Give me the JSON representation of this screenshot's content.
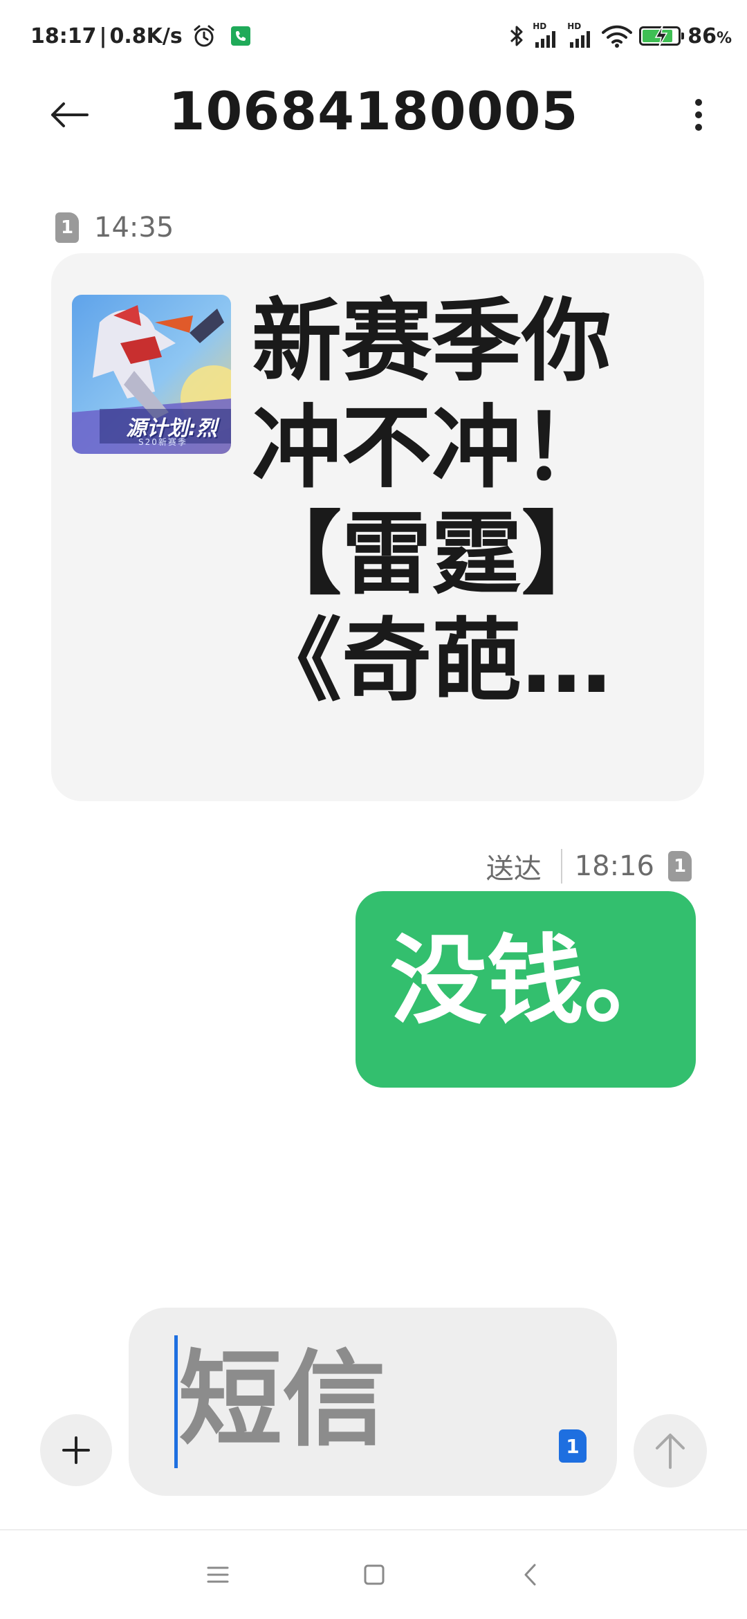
{
  "status_bar": {
    "time": "18:17",
    "separator": "|",
    "net_speed": "0.8K/s",
    "signal_1_label": "HD",
    "signal_2_label": "HD",
    "battery_percent": "86",
    "battery_suffix": "%",
    "battery_level": 0.86,
    "icons": [
      "alarm-icon",
      "phone-call-icon",
      "bluetooth-icon",
      "signal-icon",
      "wifi-icon",
      "battery-charging-icon"
    ]
  },
  "header": {
    "title": "10684180005",
    "back_icon": "arrow-left-icon",
    "more_icon": "more-vertical-icon"
  },
  "messages": [
    {
      "direction": "incoming",
      "sim": "1",
      "time": "14:35",
      "text": "新赛季你冲不冲！【雷霆】《奇葩…",
      "thumbnail_text": "源计划:烈",
      "thumbnail_sub": "S20新赛季"
    },
    {
      "direction": "outgoing",
      "status": "送达",
      "time": "18:16",
      "sim": "1",
      "text": "没钱。"
    }
  ],
  "composer": {
    "placeholder": "短信",
    "sim": "1",
    "add_icon": "plus-icon",
    "send_icon": "arrow-up-icon"
  },
  "nav_bar": {
    "icons": [
      "menu-icon",
      "home-icon",
      "back-icon"
    ]
  },
  "colors": {
    "outgoing_bubble": "#33bf6e",
    "incoming_bubble": "#f4f4f4",
    "accent": "#1e6fe0"
  }
}
